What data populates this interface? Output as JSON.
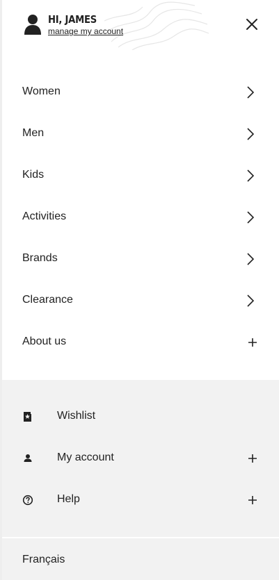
{
  "header": {
    "greeting": "HI, JAMES",
    "manage_link": "manage my account",
    "avatar_icon": "user-icon",
    "close_icon": "close-icon"
  },
  "nav": {
    "items": [
      {
        "label": "Women",
        "icon": "chevron-right-icon"
      },
      {
        "label": "Men",
        "icon": "chevron-right-icon"
      },
      {
        "label": "Kids",
        "icon": "chevron-right-icon"
      },
      {
        "label": "Activities",
        "icon": "chevron-right-icon"
      },
      {
        "label": "Brands",
        "icon": "chevron-right-icon"
      },
      {
        "label": "Clearance",
        "icon": "chevron-right-icon"
      },
      {
        "label": "About us",
        "icon": "plus-icon"
      }
    ]
  },
  "secondary": {
    "items": [
      {
        "label": "Wishlist",
        "icon": "wishlist-icon"
      },
      {
        "label": "My account",
        "icon": "user-icon",
        "expand_icon": "plus-icon"
      },
      {
        "label": "Help",
        "icon": "help-icon",
        "expand_icon": "plus-icon"
      }
    ]
  },
  "language": {
    "label": "Français"
  },
  "colors": {
    "text": "#222222",
    "secondary_bg": "#f2f2f2",
    "background": "#ffffff"
  }
}
